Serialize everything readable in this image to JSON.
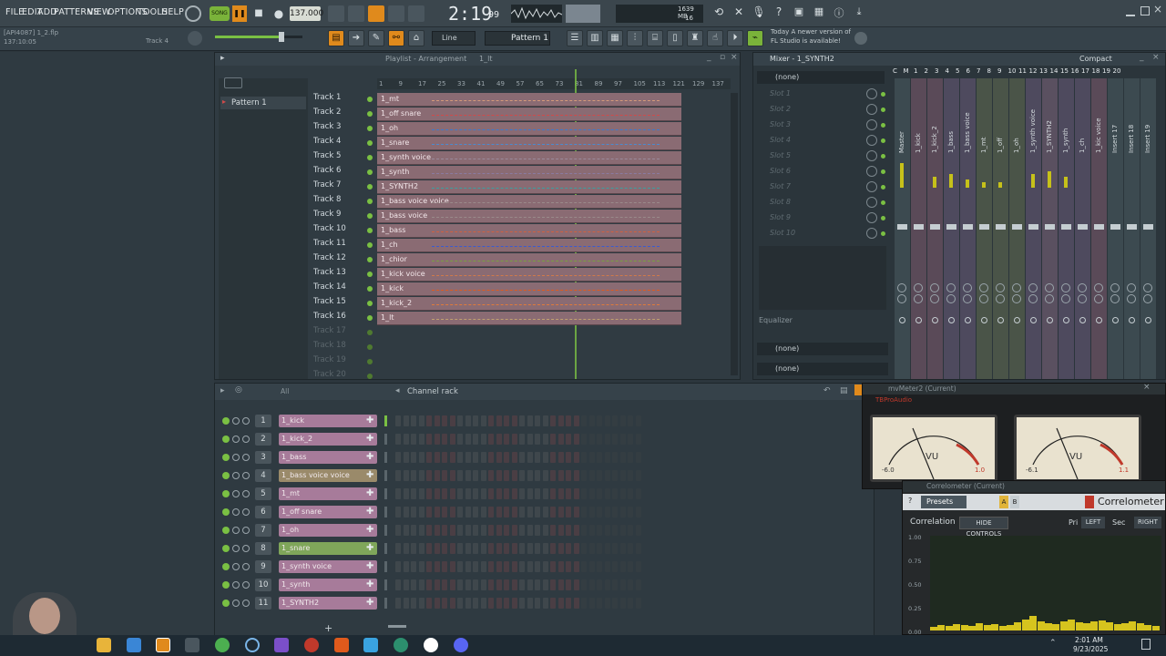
{
  "menu": [
    "FILE",
    "EDIT",
    "ADD",
    "PATTERNS",
    "VIEW",
    "OPTIONS",
    "TOOLS",
    "HELP"
  ],
  "transport": {
    "mode": "SONG",
    "tempo": "137.000",
    "time": "2:19",
    "time_ms": "99",
    "cpu_label": "1639 MB",
    "cpu_sub": "16",
    "snap": "Line",
    "pattern": "Pattern 1"
  },
  "project": {
    "hint": "[API4087] 1_2.flp",
    "timestamp": "137:10:05",
    "track_hint": "Track 4"
  },
  "news": {
    "line1": "Today  A newer version of",
    "line2": "FL Studio is available!"
  },
  "playlist": {
    "title": "Playlist - Arrangement",
    "arrangement": "1_lt",
    "ruler": [
      "1",
      "9",
      "17",
      "25",
      "33",
      "41",
      "49",
      "57",
      "65",
      "73",
      "81",
      "89",
      "97",
      "105",
      "113",
      "121",
      "129",
      "137"
    ],
    "pattern_item": "Pattern 1",
    "tracks": [
      {
        "label": "Track 1",
        "clip": "1_mt"
      },
      {
        "label": "Track 2",
        "clip": "1_off snare"
      },
      {
        "label": "Track 3",
        "clip": "1_oh"
      },
      {
        "label": "Track 4",
        "clip": "1_snare"
      },
      {
        "label": "Track 5",
        "clip": "1_synth voice"
      },
      {
        "label": "Track 6",
        "clip": "1_synth"
      },
      {
        "label": "Track 7",
        "clip": "1_SYNTH2"
      },
      {
        "label": "Track 8",
        "clip": "1_bass voice voice"
      },
      {
        "label": "Track 9",
        "clip": "1_bass voice"
      },
      {
        "label": "Track 10",
        "clip": "1_bass"
      },
      {
        "label": "Track 11",
        "clip": "1_ch"
      },
      {
        "label": "Track 12",
        "clip": "1_chior"
      },
      {
        "label": "Track 13",
        "clip": "1_kick voice"
      },
      {
        "label": "Track 14",
        "clip": "1_kick"
      },
      {
        "label": "Track 15",
        "clip": "1_kick_2"
      },
      {
        "label": "Track 16",
        "clip": "1_lt"
      },
      {
        "label": "Track 17",
        "clip": ""
      },
      {
        "label": "Track 18",
        "clip": ""
      },
      {
        "label": "Track 19",
        "clip": ""
      },
      {
        "label": "Track 20",
        "clip": ""
      }
    ]
  },
  "mixer": {
    "title": "Mixer - 1_SYNTH2",
    "view": "Compact",
    "preset": "(none)",
    "slots": [
      "Slot 1",
      "Slot 2",
      "Slot 3",
      "Slot 4",
      "Slot 5",
      "Slot 6",
      "Slot 7",
      "Slot 8",
      "Slot 9",
      "Slot 10"
    ],
    "equalizer": "Equalizer",
    "out1": "(none)",
    "out2": "(none)",
    "channels": [
      "Master",
      "1_kick",
      "1_kick_2",
      "1_bass",
      "1_bass voice",
      "1_mt",
      "1_off",
      "1_oh",
      "1_synth voice",
      "1_SYNTH2",
      "1_synth",
      "1_ch",
      "1_kic voice",
      "Insert 17",
      "Insert 18",
      "Insert 19"
    ],
    "strip_nums": [
      "C",
      "M",
      "1",
      "2",
      "3",
      "4",
      "5",
      "6",
      "7",
      "8",
      "9",
      "10",
      "11",
      "12",
      "13",
      "14",
      "15",
      "16",
      "17",
      "18",
      "19",
      "20"
    ]
  },
  "rack": {
    "title": "Channel rack",
    "filter": "All",
    "channels": [
      {
        "num": "1",
        "name": "1_kick",
        "color": "#a77b9a"
      },
      {
        "num": "2",
        "name": "1_kick_2",
        "color": "#a77b9a"
      },
      {
        "num": "3",
        "name": "1_bass",
        "color": "#a77b9a"
      },
      {
        "num": "4",
        "name": "1_bass voice voice",
        "color": "#9a8a6a"
      },
      {
        "num": "5",
        "name": "1_mt",
        "color": "#a77b9a"
      },
      {
        "num": "6",
        "name": "1_off snare",
        "color": "#a77b9a"
      },
      {
        "num": "7",
        "name": "1_oh",
        "color": "#a77b9a"
      },
      {
        "num": "8",
        "name": "1_snare",
        "color": "#7fa65a"
      },
      {
        "num": "9",
        "name": "1_synth voice",
        "color": "#a77b9a"
      },
      {
        "num": "10",
        "name": "1_synth",
        "color": "#a77b9a"
      },
      {
        "num": "11",
        "name": "1_SYNTH2",
        "color": "#a77b9a"
      }
    ]
  },
  "mvmeter": {
    "title": "mvMeter2 (Current)",
    "brand": "TBProAudio",
    "left_label": "VU",
    "right_label": "VU",
    "left_val": "-6.0",
    "left_peak": "1.0",
    "right_val": "-6.1",
    "right_peak": "1.1"
  },
  "correl": {
    "title": "Correlometer (Current)",
    "presets": "Presets",
    "brand": "Correlometer",
    "tab": "Correlation",
    "hide": "HIDE CONTROLS",
    "pri": "Pri",
    "left": "LEFT",
    "sec": "Sec",
    "right": "RIGHT",
    "yticks": [
      "1.00",
      "0.75",
      "0.50",
      "0.25",
      "0.00"
    ]
  },
  "taskbar": {
    "time": "2:01 AM",
    "date": "9/23/2025"
  },
  "colors": {
    "accent": "#e08a1c",
    "clip": "#8a6b73",
    "green": "#7ac043",
    "meter": "#d6c41e"
  }
}
